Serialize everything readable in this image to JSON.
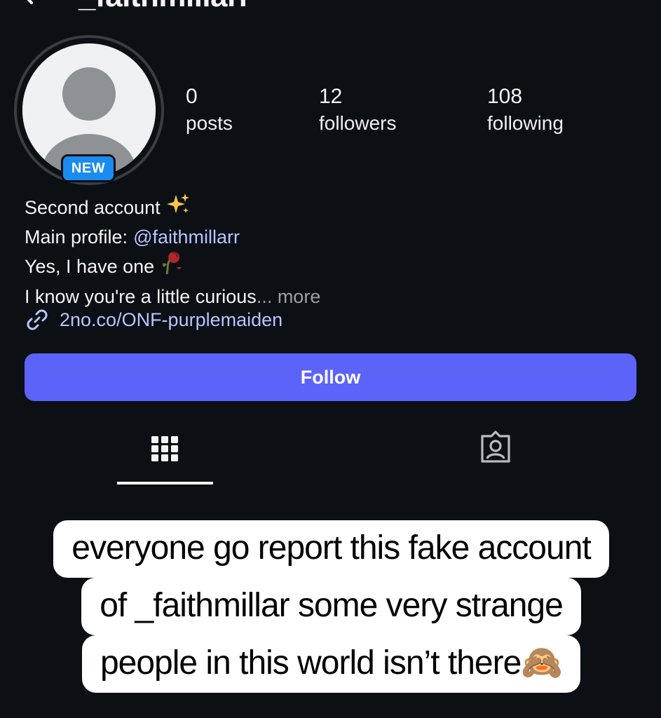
{
  "header": {
    "username": "_faithmillarr",
    "back_icon": "chevron-left-icon"
  },
  "profile": {
    "badge": "NEW",
    "stats": [
      {
        "value": "0",
        "label": "posts"
      },
      {
        "value": "12",
        "label": "followers"
      },
      {
        "value": "108",
        "label": "following"
      }
    ]
  },
  "bio": {
    "line1": "Second account",
    "line1_emoji": "sparkles-emoji",
    "line2_prefix": "Main profile: ",
    "line2_mention": "@faithmillarr",
    "line3": "Yes, I have one",
    "line3_emoji": "wilted-rose-emoji",
    "line4": "I know you're a little curious",
    "line4_more": "... more",
    "link": "2no.co/ONF-purplemaiden"
  },
  "actions": {
    "follow_label": "Follow"
  },
  "tabs": [
    {
      "name": "grid",
      "icon": "grid-icon",
      "active": true
    },
    {
      "name": "tagged",
      "icon": "tagged-person-icon",
      "active": false
    }
  ],
  "caption": {
    "line1": "everyone go report this fake account",
    "line2": "of _faithmillar some very strange",
    "line3": "people in this world isn’t there",
    "emoji": "🙈"
  },
  "colors": {
    "background": "#0c0f14",
    "follow_button": "#5b63f8",
    "link": "#b6c6ff",
    "new_badge": "#1a8cf0"
  }
}
